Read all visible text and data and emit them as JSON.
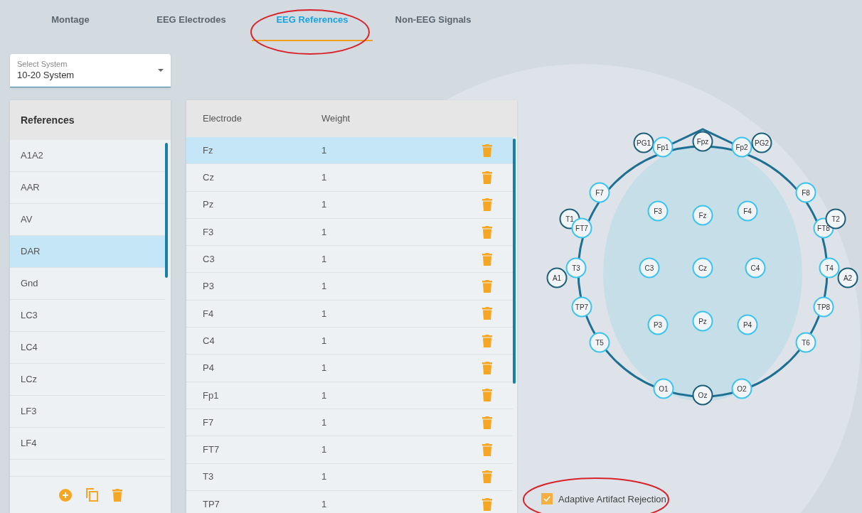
{
  "tabs": [
    {
      "label": "Montage",
      "selected": false
    },
    {
      "label": "EEG Electrodes",
      "selected": false
    },
    {
      "label": "EEG References",
      "selected": true
    },
    {
      "label": "Non-EEG Signals",
      "selected": false
    }
  ],
  "system_select": {
    "label": "Select System",
    "value": "10-20 System"
  },
  "references": {
    "title": "References",
    "items": [
      {
        "label": "A1A2",
        "selected": false
      },
      {
        "label": "AAR",
        "selected": false
      },
      {
        "label": "AV",
        "selected": false
      },
      {
        "label": "DAR",
        "selected": true
      },
      {
        "label": "Gnd",
        "selected": false
      },
      {
        "label": "LC3",
        "selected": false
      },
      {
        "label": "LC4",
        "selected": false
      },
      {
        "label": "LCz",
        "selected": false
      },
      {
        "label": "LF3",
        "selected": false
      },
      {
        "label": "LF4",
        "selected": false
      }
    ]
  },
  "table": {
    "columns": [
      "Electrode",
      "Weight"
    ],
    "rows": [
      {
        "electrode": "Fz",
        "weight": "1",
        "selected": true
      },
      {
        "electrode": "Cz",
        "weight": "1",
        "selected": false
      },
      {
        "electrode": "Pz",
        "weight": "1",
        "selected": false
      },
      {
        "electrode": "F3",
        "weight": "1",
        "selected": false
      },
      {
        "electrode": "C3",
        "weight": "1",
        "selected": false
      },
      {
        "electrode": "P3",
        "weight": "1",
        "selected": false
      },
      {
        "electrode": "F4",
        "weight": "1",
        "selected": false
      },
      {
        "electrode": "C4",
        "weight": "1",
        "selected": false
      },
      {
        "electrode": "P4",
        "weight": "1",
        "selected": false
      },
      {
        "electrode": "Fp1",
        "weight": "1",
        "selected": false
      },
      {
        "electrode": "F7",
        "weight": "1",
        "selected": false
      },
      {
        "electrode": "FT7",
        "weight": "1",
        "selected": false
      },
      {
        "electrode": "T3",
        "weight": "1",
        "selected": false
      },
      {
        "electrode": "TP7",
        "weight": "1",
        "selected": false
      }
    ]
  },
  "electrode_map": [
    {
      "label": "PG1",
      "kind": "outer"
    },
    {
      "label": "Fp1",
      "kind": "standard"
    },
    {
      "label": "Fpz",
      "kind": "outer"
    },
    {
      "label": "Fp2",
      "kind": "standard"
    },
    {
      "label": "PG2",
      "kind": "outer"
    },
    {
      "label": "F7",
      "kind": "standard"
    },
    {
      "label": "F3",
      "kind": "standard"
    },
    {
      "label": "Fz",
      "kind": "standard"
    },
    {
      "label": "F4",
      "kind": "standard"
    },
    {
      "label": "F8",
      "kind": "standard"
    },
    {
      "label": "T1",
      "kind": "outer"
    },
    {
      "label": "FT7",
      "kind": "standard"
    },
    {
      "label": "FT8",
      "kind": "standard"
    },
    {
      "label": "T2",
      "kind": "outer"
    },
    {
      "label": "T3",
      "kind": "standard"
    },
    {
      "label": "A1",
      "kind": "outer"
    },
    {
      "label": "C3",
      "kind": "standard"
    },
    {
      "label": "Cz",
      "kind": "standard"
    },
    {
      "label": "C4",
      "kind": "standard"
    },
    {
      "label": "T4",
      "kind": "standard"
    },
    {
      "label": "A2",
      "kind": "outer"
    },
    {
      "label": "TP7",
      "kind": "standard"
    },
    {
      "label": "P3",
      "kind": "standard"
    },
    {
      "label": "Pz",
      "kind": "standard"
    },
    {
      "label": "P4",
      "kind": "standard"
    },
    {
      "label": "TP8",
      "kind": "standard"
    },
    {
      "label": "T5",
      "kind": "standard"
    },
    {
      "label": "T6",
      "kind": "standard"
    },
    {
      "label": "O1",
      "kind": "standard"
    },
    {
      "label": "Oz",
      "kind": "outer"
    },
    {
      "label": "O2",
      "kind": "standard"
    }
  ],
  "artifact_rejection": {
    "label": "Adaptive Artifact Rejection",
    "checked": true
  }
}
